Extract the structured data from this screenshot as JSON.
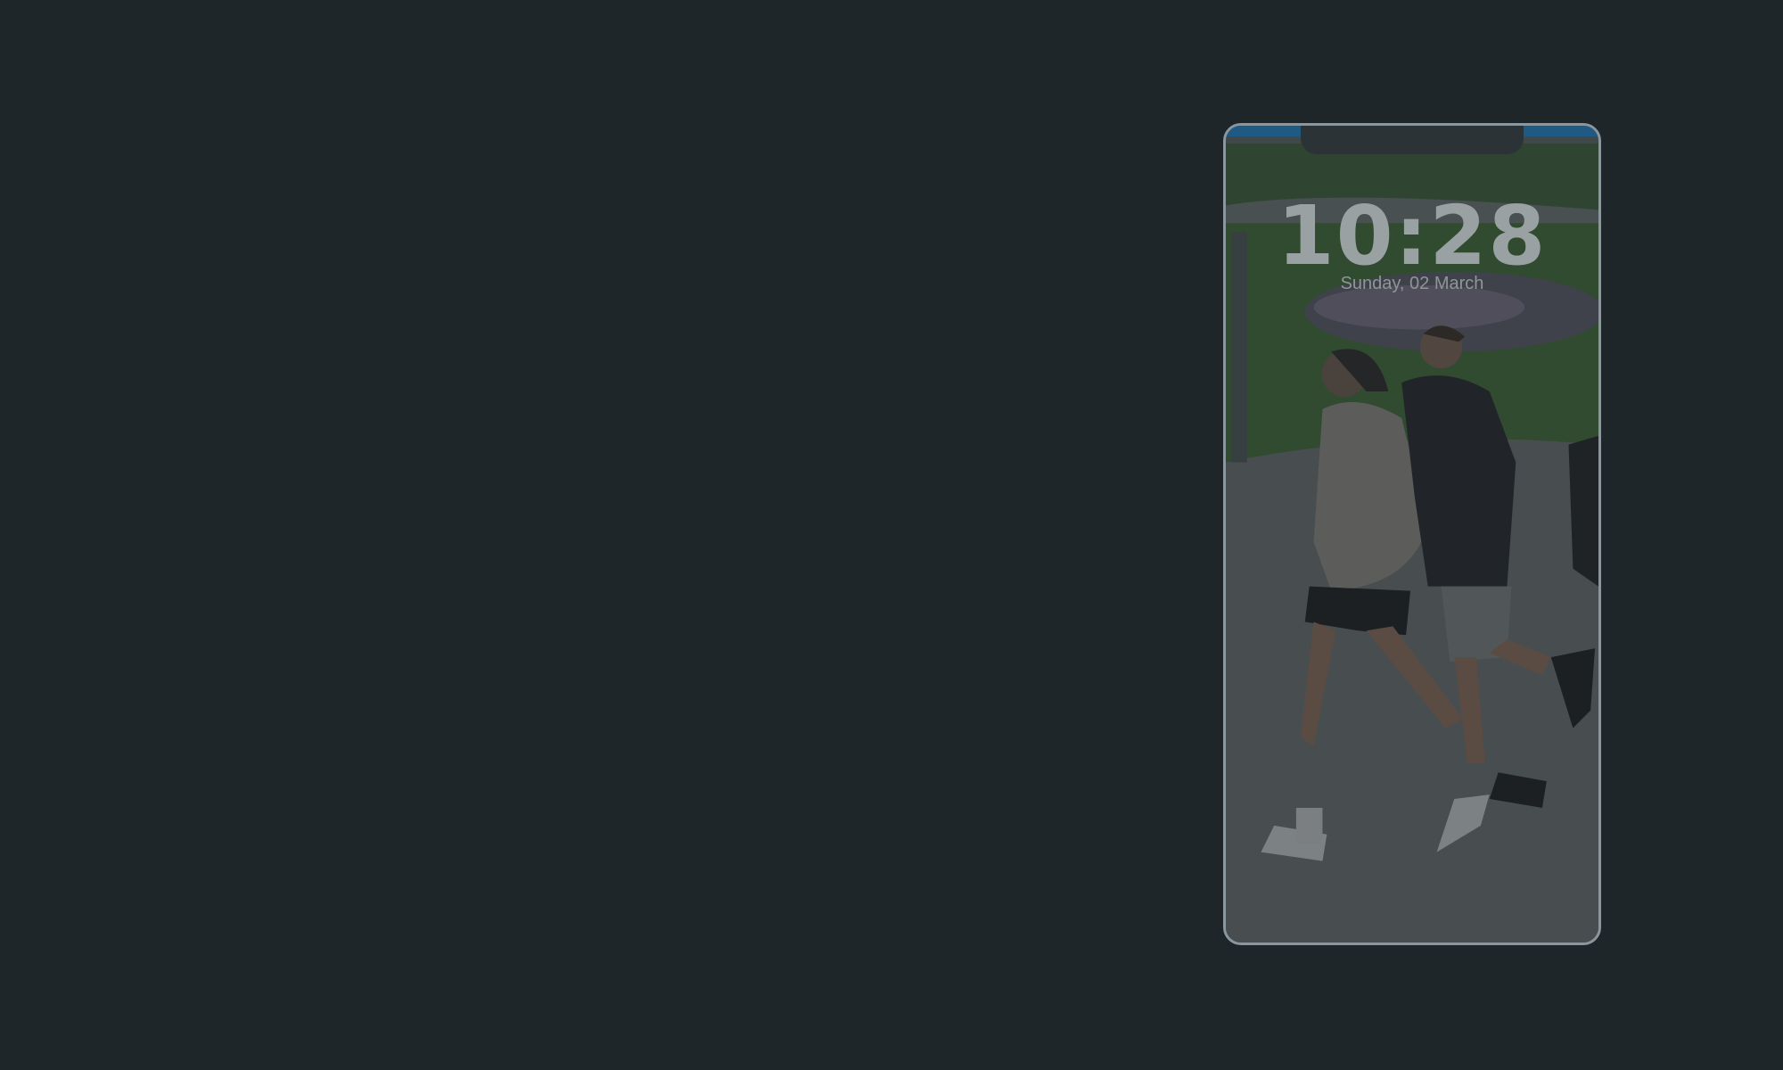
{
  "lockscreen": {
    "time": "10:28",
    "date": "Sunday, 02 March"
  },
  "colors": {
    "page_background": "#1f2629",
    "phone_border": "#8a979e",
    "status_strip": "#1f5a84",
    "clock_text": "#9aa1a3"
  },
  "wallpaper": {
    "description_icon": "wallpaper-photo"
  }
}
